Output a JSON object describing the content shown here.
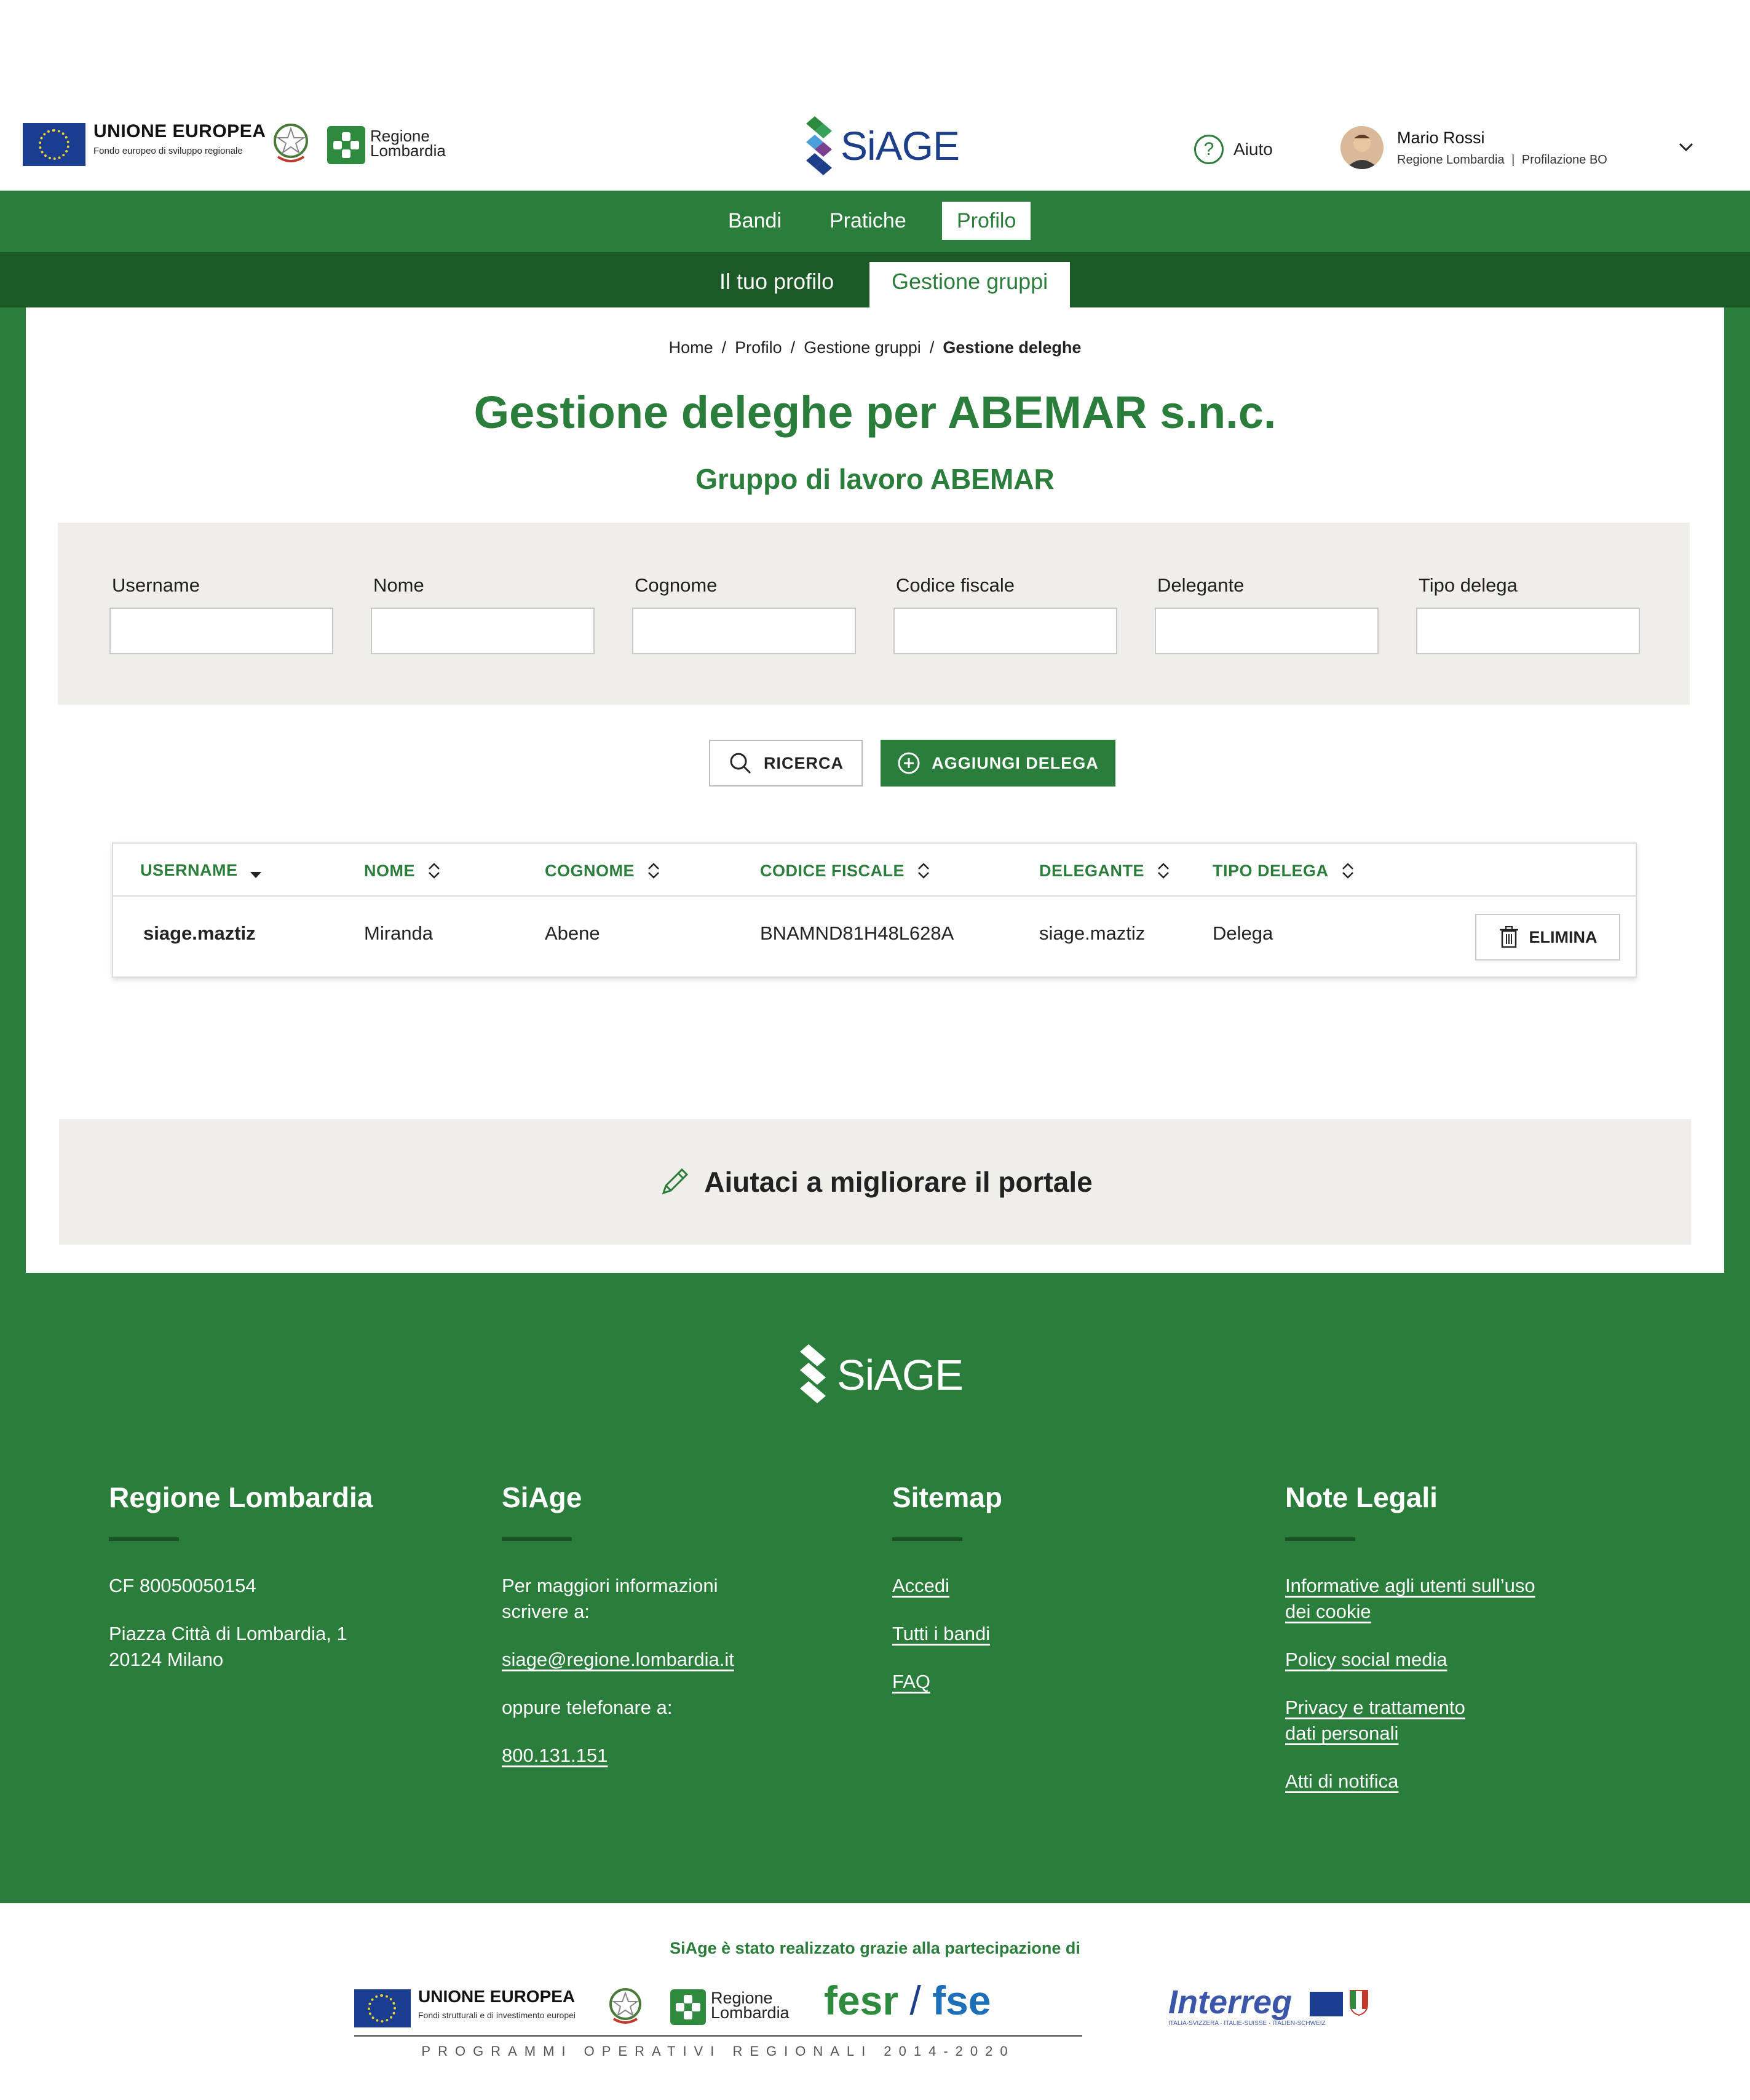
{
  "header": {
    "eu_title": "UNIONE EUROPEA",
    "eu_subtitle": "Fondo europeo di sviluppo regionale",
    "region_logo_text": "Regione\nLombardia",
    "app_name": "SiAGE",
    "help_label": "Aiuto",
    "user_name": "Mario Rossi",
    "user_org": "Regione Lombardia",
    "user_role": "Profilazione BO",
    "user_separator": "|"
  },
  "nav": {
    "main": [
      {
        "label": "Bandi",
        "active": false
      },
      {
        "label": "Pratiche",
        "active": false
      },
      {
        "label": "Profilo",
        "active": true
      }
    ],
    "sub": [
      {
        "label": "Il tuo profilo",
        "active": false
      },
      {
        "label": "Gestione gruppi",
        "active": true
      }
    ]
  },
  "breadcrumb": {
    "items": [
      "Home",
      "Profilo",
      "Gestione gruppi"
    ],
    "current": "Gestione deleghe",
    "separator": "/"
  },
  "page": {
    "title": "Gestione deleghe per ABEMAR s.n.c.",
    "subtitle": "Gruppo di lavoro ABEMAR"
  },
  "filters": [
    {
      "label": "Username",
      "value": ""
    },
    {
      "label": "Nome",
      "value": ""
    },
    {
      "label": "Cognome",
      "value": ""
    },
    {
      "label": "Codice fiscale",
      "value": ""
    },
    {
      "label": "Delegante",
      "value": ""
    },
    {
      "label": "Tipo delega",
      "value": ""
    }
  ],
  "actions": {
    "search_label": "RICERCA",
    "add_label": "AGGIUNGI DELEGA"
  },
  "table": {
    "columns": [
      "USERNAME",
      "NOME",
      "COGNOME",
      "CODICE FISCALE",
      "DELEGANTE",
      "TIPO DELEGA"
    ],
    "sorted_column": "USERNAME",
    "rows": [
      {
        "username": "siage.maztiz",
        "nome": "Miranda",
        "cognome": "Abene",
        "codice_fiscale": "BNAMND81H48L628A",
        "delegante": "siage.maztiz",
        "tipo_delega": "Delega",
        "delete_label": "ELIMINA"
      }
    ]
  },
  "feedback": {
    "label": "Aiutaci a migliorare il portale"
  },
  "footer": {
    "logo": "SiAGE",
    "regione": {
      "title": "Regione Lombardia",
      "cf": "CF 80050050154",
      "address_line1": "Piazza Città di Lombardia, 1",
      "address_line2": "20124 Milano"
    },
    "siage": {
      "title": "SiAge",
      "info_line1": "Per maggiori informazioni",
      "info_line2": "scrivere a:",
      "email": "siage@regione.lombardia.it",
      "phone_intro": "oppure telefonare a:",
      "phone": "800.131.151"
    },
    "sitemap": {
      "title": "Sitemap",
      "links": [
        "Accedi",
        "Tutti i bandi",
        "FAQ"
      ]
    },
    "legal": {
      "title": "Note Legali",
      "links": [
        {
          "line1": "Informative agli utenti sull’uso",
          "line2": "dei cookie"
        },
        {
          "line1": "Policy social media",
          "line2": ""
        },
        {
          "line1": "Privacy e trattamento",
          "line2": "dati personali"
        },
        {
          "line1": "Atti di notifica",
          "line2": ""
        }
      ]
    }
  },
  "partners": {
    "note": "SiAge è stato realizzato grazie alla partecipazione di",
    "eu_title": "UNIONE EUROPEA",
    "eu_subtitle": "Fondi strutturali e di investimento europei",
    "region_text": "Regione\nLombardia",
    "fesr": "fesr",
    "slash": "/",
    "fse": "fse",
    "interreg": "Interreg",
    "interreg_sub": "ITALIA-SVIZZERA · ITALIE-SUISSE · ITALIEN-SCHWEIZ",
    "programmes": "PROGRAMMI OPERATIVI REGIONALI 2014-2020"
  },
  "colors": {
    "brand_green": "#2a7d3a",
    "dark_green": "#1b5927",
    "panel_grey": "#efeeea",
    "siage_blue": "#1d3f8a"
  }
}
